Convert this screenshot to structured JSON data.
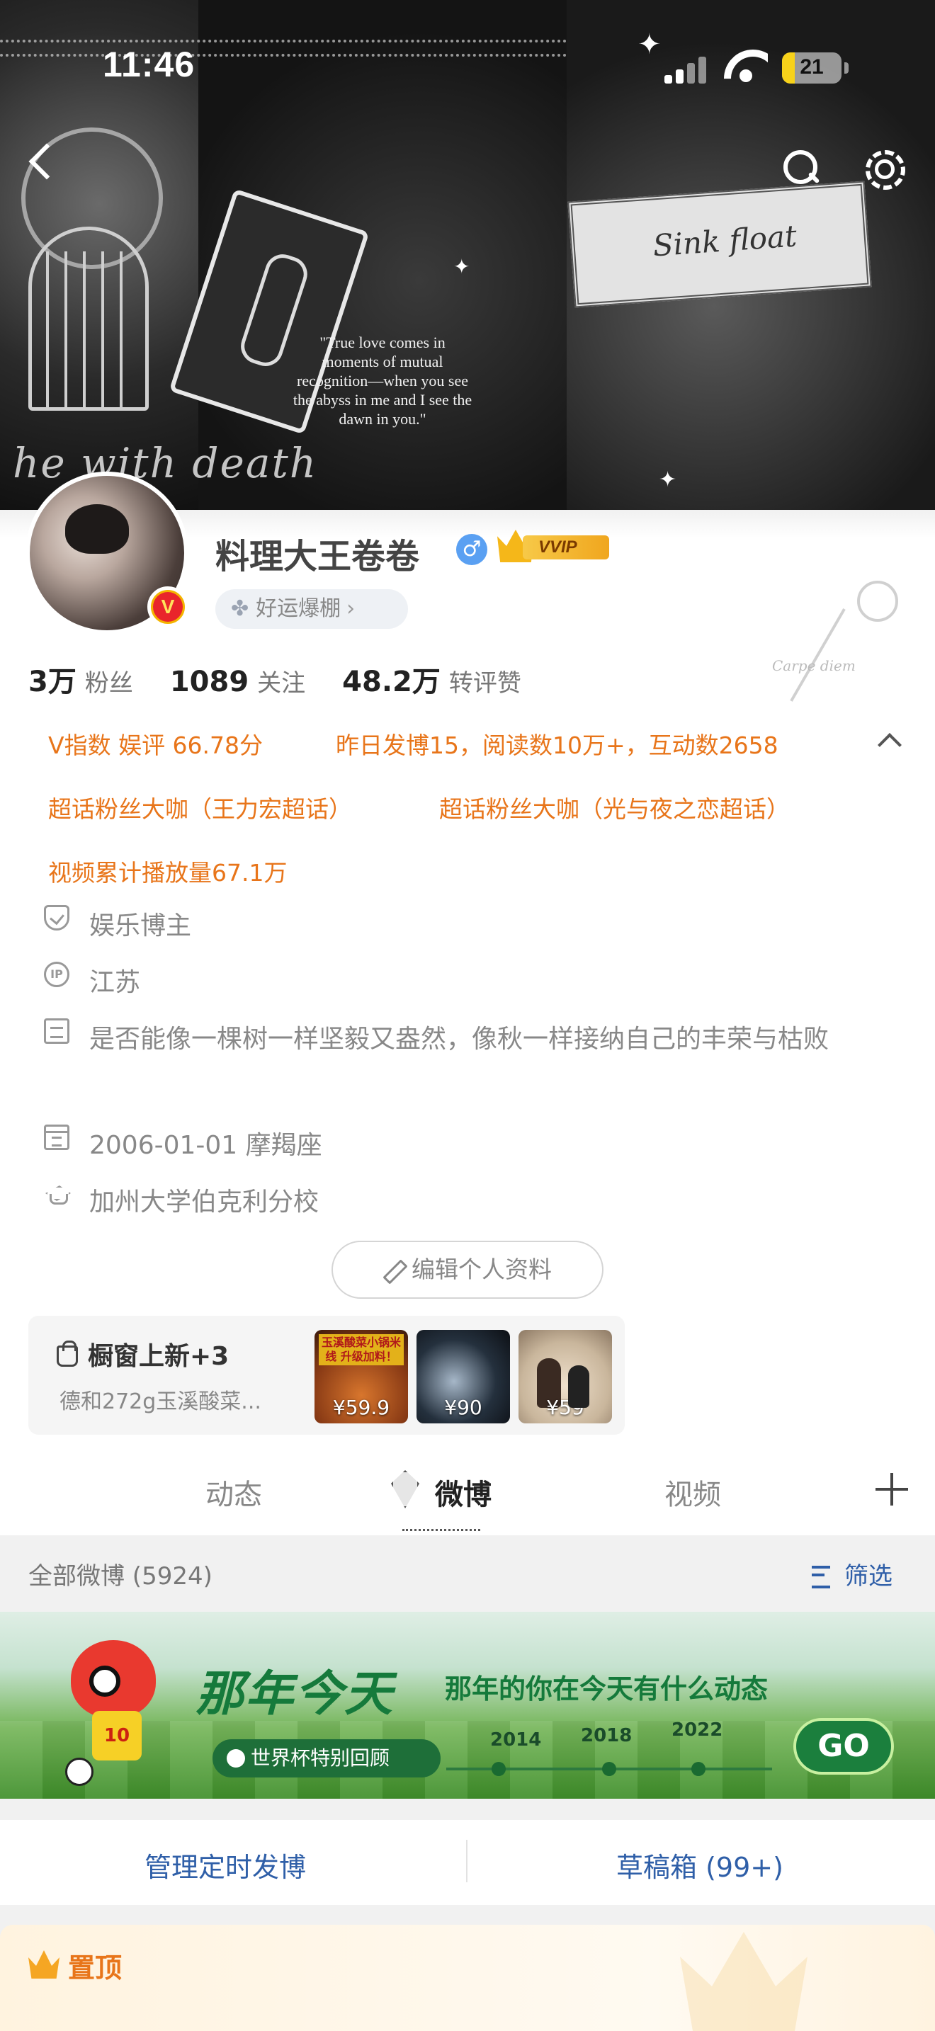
{
  "status_bar": {
    "time": "11:46",
    "battery": "21"
  },
  "cover": {
    "quote": "\"True love comes in moments of mutual recognition—when you see the abyss in me and I see the dawn in you.\"",
    "script_text": "he    with death"
  },
  "profile": {
    "username": "料理大王卷卷",
    "gender_symbol": "♂",
    "vip_label": "VVIP",
    "luck_label": "好运爆棚",
    "stats": [
      {
        "value": "3万",
        "label": "粉丝"
      },
      {
        "value": "1089",
        "label": "关注"
      },
      {
        "value": "48.2万",
        "label": "转评赞"
      }
    ],
    "highlights": {
      "v_index": "V指数 娱评 66.78分",
      "yesterday": "昨日发博15，阅读数10万+，互动数2658",
      "super_fan_1": "超话粉丝大咖（王力宏超话）",
      "super_fan_2": "超话粉丝大咖（光与夜之恋超话）",
      "video_plays": "视频累计播放量67.1万"
    },
    "info": {
      "category": "娱乐博主",
      "ip_icon": "IP",
      "ip_location": "江苏",
      "bio": "是否能像一棵树一样坚毅又盎然，像秋一样接纳自己的丰荣与枯败",
      "birthday": "2006-01-01 摩羯座",
      "school": "加州大学伯克利分校"
    },
    "edit_button": "编辑个人资料"
  },
  "shop": {
    "title": "橱窗上新+3",
    "subtitle": "德和272g玉溪酸菜...",
    "items": [
      {
        "banner": "玉溪酸菜小锅米线 升级加料！",
        "price": "¥59.9"
      },
      {
        "price": "¥90"
      },
      {
        "price": "¥59"
      }
    ]
  },
  "tabs": {
    "items": [
      "动态",
      "微博",
      "视频"
    ],
    "active": "微博"
  },
  "feed": {
    "header": "全部微博 (5924)",
    "filter": "筛选",
    "banner": {
      "title": "那年今天",
      "subtitle": "那年的你在今天有什么动态",
      "pill": "世界杯特别回顾",
      "jersey": "10",
      "years": [
        "2014",
        "2018",
        "2022"
      ],
      "go": "GO"
    },
    "actions": {
      "scheduled": "管理定时发博",
      "drafts": "草稿箱 (99+)"
    },
    "pinned": "置顶"
  },
  "colors": {
    "accent_orange": "#e8751a",
    "link_blue": "#2f5fa8",
    "banner_green": "#157a3b"
  }
}
